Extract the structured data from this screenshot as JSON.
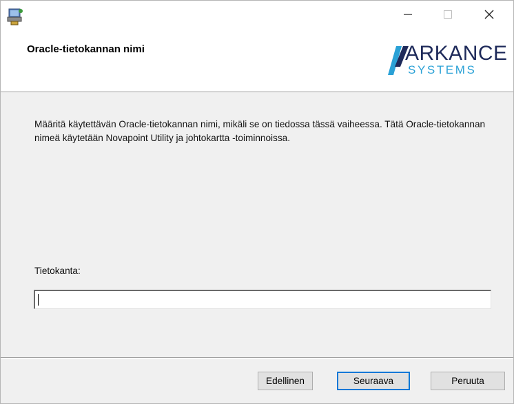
{
  "window": {
    "app_icon": "installer-package-icon",
    "controls": {
      "minimize_icon": "minimize-icon",
      "maximize_icon": "maximize-icon",
      "close_icon": "close-icon"
    }
  },
  "header": {
    "title": "Oracle-tietokannan nimi",
    "logo": {
      "line1": "ARKANCE",
      "line2": "SYSTEMS",
      "primary_color": "#1e2a5a",
      "secondary_color": "#2aa1d6"
    }
  },
  "main": {
    "description": "Määritä käytettävän Oracle-tietokannan nimi, mikäli se on tiedossa tässä vaiheessa. Tätä Oracle-tietokannan nimeä käytetään Novapoint Utility ja johtokartta -toiminnoissa.",
    "field_label": "Tietokanta:",
    "field_value": ""
  },
  "footer": {
    "back_label": "Edellinen",
    "next_label": "Seuraava",
    "cancel_label": "Peruuta",
    "focus_color": "#0078d7"
  }
}
